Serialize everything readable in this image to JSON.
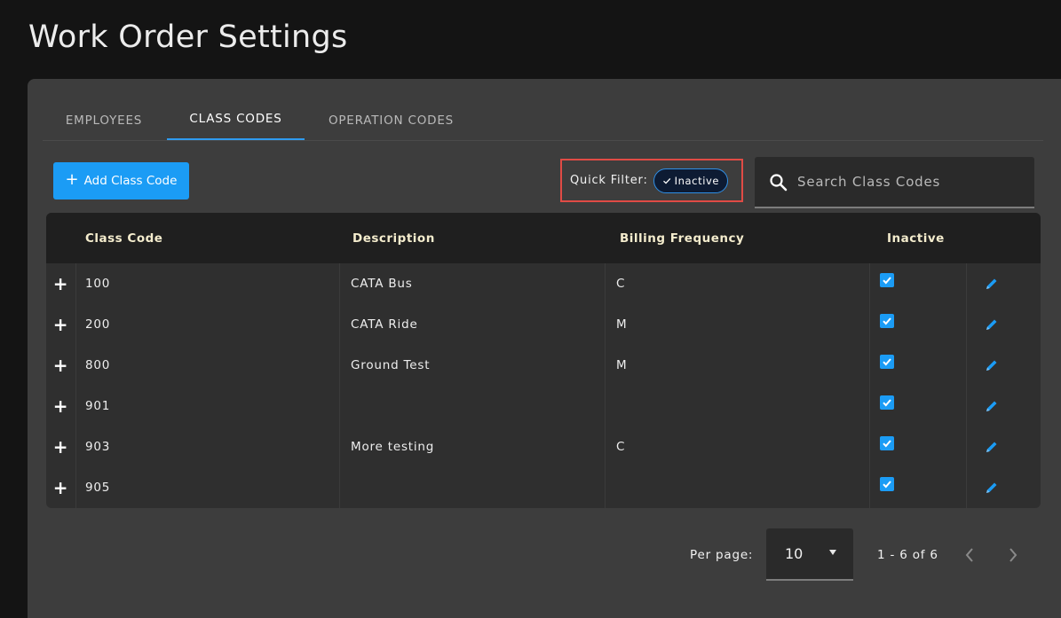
{
  "page": {
    "title": "Work Order Settings"
  },
  "tabs": [
    {
      "label": "EMPLOYEES",
      "active": false
    },
    {
      "label": "CLASS CODES",
      "active": true
    },
    {
      "label": "OPERATION CODES",
      "active": false
    }
  ],
  "toolbar": {
    "add_button_label": "Add Class Code",
    "quick_filter_label": "Quick Filter:",
    "chip_label": "Inactive",
    "search_placeholder": "Search Class Codes"
  },
  "table": {
    "headers": {
      "class_code": "Class Code",
      "description": "Description",
      "billing_frequency": "Billing Frequency",
      "inactive": "Inactive"
    },
    "rows": [
      {
        "class_code": "100",
        "description": "CATA Bus",
        "billing_frequency": "C",
        "inactive": true
      },
      {
        "class_code": "200",
        "description": "CATA Ride",
        "billing_frequency": "M",
        "inactive": true
      },
      {
        "class_code": "800",
        "description": "Ground Test",
        "billing_frequency": "M",
        "inactive": true
      },
      {
        "class_code": "901",
        "description": "",
        "billing_frequency": "",
        "inactive": true
      },
      {
        "class_code": "903",
        "description": "More testing",
        "billing_frequency": "C",
        "inactive": true
      },
      {
        "class_code": "905",
        "description": "",
        "billing_frequency": "",
        "inactive": true
      }
    ]
  },
  "pagination": {
    "per_page_label": "Per page:",
    "per_page_value": "10",
    "range_text": "1 - 6 of 6"
  },
  "colors": {
    "accent": "#1b9cf5",
    "highlight_border": "#e04b45",
    "header_text": "#f4eccd"
  },
  "icons": [
    "plus-icon",
    "check-icon",
    "search-icon",
    "expand-icon",
    "checkbox-checked-icon",
    "pencil-icon",
    "caret-down-icon",
    "chevron-left-icon",
    "chevron-right-icon"
  ]
}
